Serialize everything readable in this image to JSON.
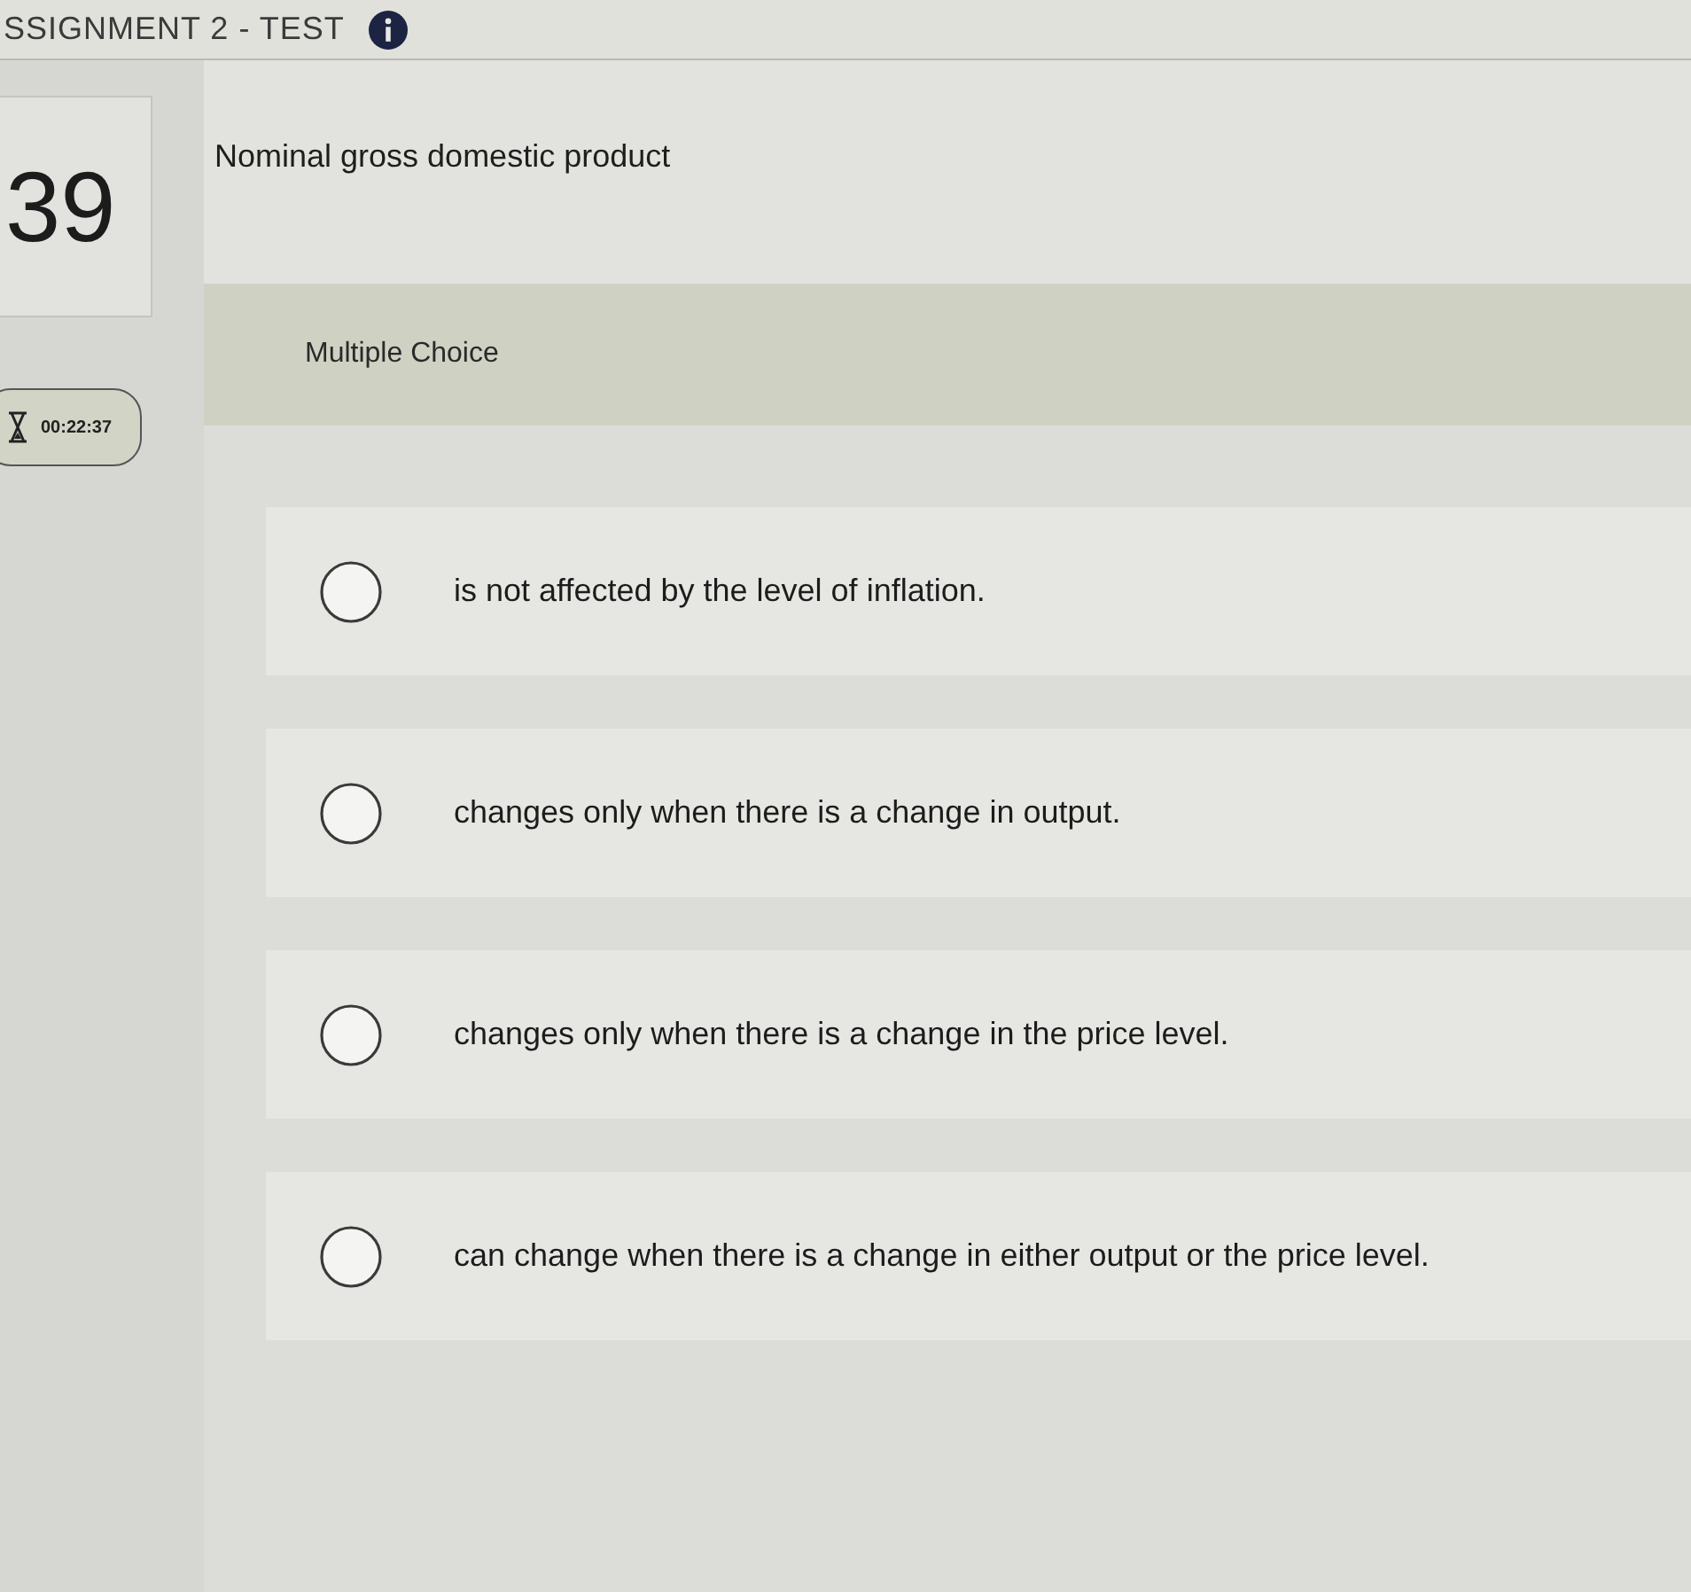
{
  "header": {
    "title": "SSIGNMENT 2 - TEST"
  },
  "question": {
    "number": "39",
    "text": "Nominal gross domestic product",
    "type": "Multiple Choice"
  },
  "timer": {
    "time": "00:22:37"
  },
  "options": [
    {
      "text": "is not affected by the level of inflation.",
      "selected": false
    },
    {
      "text": "changes only when there is a change in output.",
      "selected": false
    },
    {
      "text": "changes only when there is a change in the price level.",
      "selected": false
    },
    {
      "text": "can change when there is a change in either output or the price level.",
      "selected": false
    }
  ]
}
